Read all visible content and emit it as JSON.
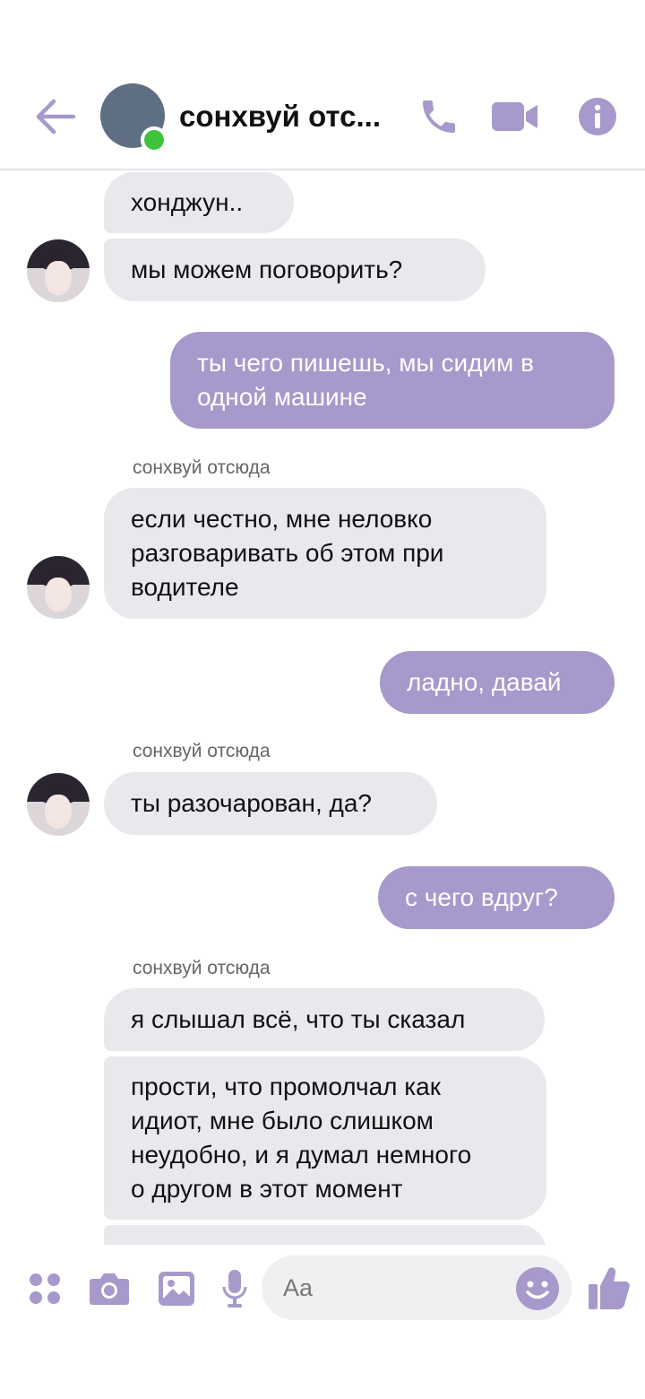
{
  "header": {
    "title": "сонхвуй отс...",
    "icons": [
      "back-arrow-icon",
      "phone-icon",
      "video-camera-icon",
      "info-icon"
    ]
  },
  "colors": {
    "accent": "#a799cb",
    "incoming_bubble": "#e9e8ed",
    "online": "#3ec33b"
  },
  "messages": [
    {
      "side": "in",
      "text": "хонджун.."
    },
    {
      "side": "in",
      "text": "мы можем поговорить?"
    },
    {
      "side": "out",
      "lines": [
        "ты чего пишешь, мы сидим в",
        "одной машине"
      ]
    },
    {
      "side": "in",
      "sender": "сонхвуй отсюда",
      "lines": [
        "если честно, мне неловко",
        "разговаривать об этом при",
        "водителе"
      ]
    },
    {
      "side": "out",
      "text": "ладно, давай"
    },
    {
      "side": "in",
      "sender": "сонхвуй отсюда",
      "text": "ты разочарован, да?"
    },
    {
      "side": "out",
      "text": "с чего вдруг?"
    },
    {
      "side": "in",
      "sender": "сонхвуй отсюда",
      "text": "я слышал всё, что ты сказал"
    },
    {
      "side": "in",
      "lines": [
        "прости, что промолчал как",
        "идиот, мне было слишком",
        "неудобно, и я думал немного",
        "о другом в этот момент"
      ]
    }
  ],
  "composer": {
    "placeholder": "Aa",
    "icons": [
      "apps-icon",
      "camera-icon",
      "image-icon",
      "microphone-icon",
      "emoji-icon",
      "thumbs-up-icon"
    ]
  }
}
